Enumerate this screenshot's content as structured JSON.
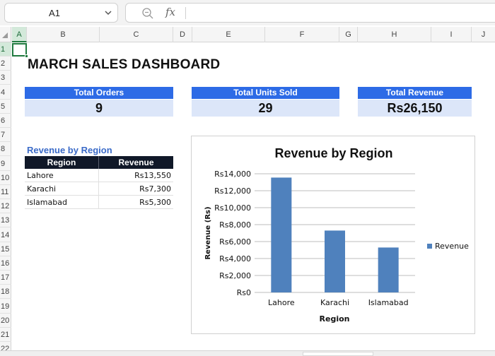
{
  "formula_bar": {
    "name_box": "A1",
    "fx_label": "fx",
    "formula": ""
  },
  "columns": [
    {
      "label": "A",
      "active": true
    },
    {
      "label": "B"
    },
    {
      "label": "C"
    },
    {
      "label": "D"
    },
    {
      "label": "E"
    },
    {
      "label": "F"
    },
    {
      "label": "G"
    },
    {
      "label": "H"
    },
    {
      "label": "I"
    },
    {
      "label": "J"
    }
  ],
  "rows": [
    "1",
    "2",
    "3",
    "4",
    "5",
    "6",
    "7",
    "8",
    "9",
    "10",
    "11",
    "12",
    "13",
    "14",
    "15",
    "16",
    "17",
    "18",
    "19",
    "20",
    "21",
    "22"
  ],
  "dashboard": {
    "title": "MARCH SALES DASHBOARD",
    "kpis": [
      {
        "label": "Total Orders",
        "value": "9"
      },
      {
        "label": "Total Units Sold",
        "value": "29"
      },
      {
        "label": "Total Revenue",
        "value": "Rs26,150"
      }
    ]
  },
  "region_table": {
    "heading": "Revenue by Region",
    "headers": [
      "Region",
      "Revenue"
    ],
    "rows": [
      [
        "Lahore",
        "Rs13,550"
      ],
      [
        "Karachi",
        "Rs7,300"
      ],
      [
        "Islamabad",
        "Rs5,300"
      ]
    ]
  },
  "chart_data": {
    "type": "bar",
    "title": "Revenue by Region",
    "xlabel": "Region",
    "ylabel": "Revenue (Rs)",
    "categories": [
      "Lahore",
      "Karachi",
      "Islamabad"
    ],
    "series": [
      {
        "name": "Revenue",
        "values": [
          13550,
          7300,
          5300
        ]
      }
    ],
    "ylim": [
      0,
      14000
    ],
    "yticks": [
      0,
      2000,
      4000,
      6000,
      8000,
      10000,
      12000,
      14000
    ],
    "ytick_labels": [
      "Rs0",
      "Rs2,000",
      "Rs4,000",
      "Rs6,000",
      "Rs8,000",
      "Rs10,000",
      "Rs12,000",
      "Rs14,000"
    ],
    "grid": true,
    "legend": "right",
    "bar_color": "#4f81bd"
  },
  "colors": {
    "accent": "#1f7a3f",
    "kpi_header": "#2d6be6",
    "kpi_value_bg": "#dce6f9",
    "table_header": "#101828"
  },
  "icons": {
    "name_box_dropdown": "chevron-down-icon",
    "zoom": "zoom-search-icon",
    "fx": "fx-icon"
  }
}
